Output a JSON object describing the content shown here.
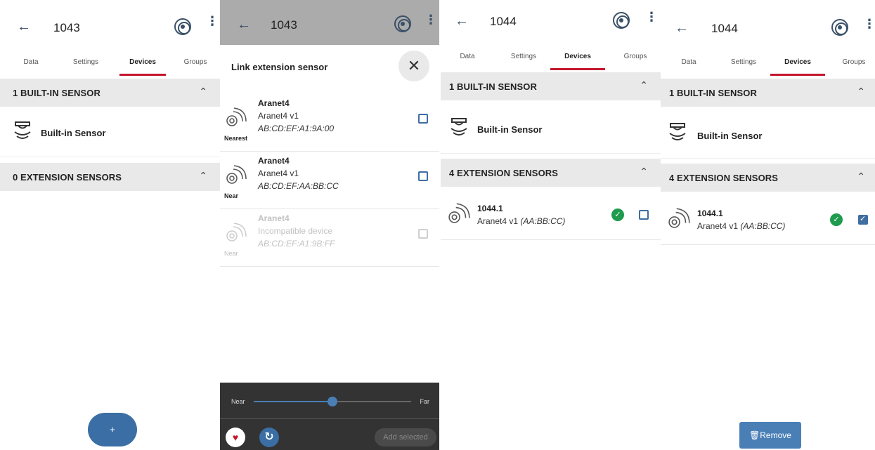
{
  "screens": [
    {
      "title": "1043",
      "tabs": [
        "Data",
        "Settings",
        "Devices",
        "Groups"
      ],
      "active_tab": "Devices",
      "builtin_header": "1 BUILT-IN SENSOR",
      "builtin_name": "Built-in Sensor",
      "ext_header": "0 EXTENSION SENSORS",
      "fab_label": "+"
    },
    {
      "title": "1043",
      "sheet_title": "Link extension sensor",
      "devices": [
        {
          "name": "Aranet4",
          "model": "Aranet4 v1",
          "mac": "AB:CD:EF:A1:9A:00",
          "proximity": "Nearest",
          "compatible": true
        },
        {
          "name": "Aranet4",
          "model": "Aranet4 v1",
          "mac": "AB:CD:EF:AA:BB:CC",
          "proximity": "Near",
          "compatible": true
        },
        {
          "name": "Aranet4",
          "model": "Incompatible device",
          "mac": "AB:CD:EF:A1:9B:FF",
          "proximity": "Near",
          "compatible": false
        }
      ],
      "slider": {
        "near_label": "Near",
        "far_label": "Far",
        "value": 0.5
      },
      "add_selected_label": "Add selected"
    },
    {
      "title": "1044",
      "tabs": [
        "Data",
        "Settings",
        "Devices",
        "Groups"
      ],
      "active_tab": "Devices",
      "builtin_header": "1 BUILT-IN SENSOR",
      "builtin_name": "Built-in Sensor",
      "ext_header": "4 EXTENSION SENSORS",
      "ext_sensor": {
        "name": "1044.1",
        "model": "Aranet4 v1",
        "mac": "(AA:BB:CC)",
        "checked": false
      }
    },
    {
      "title": "1044",
      "tabs": [
        "Data",
        "Settings",
        "Devices",
        "Groups"
      ],
      "active_tab": "Devices",
      "builtin_header": "1 BUILT-IN SENSOR",
      "builtin_name": "Built-in Sensor",
      "ext_header": "4 EXTENSION SENSORS",
      "ext_sensor": {
        "name": "1044.1",
        "model": "Aranet4 v1",
        "mac": "(AA:BB:CC)",
        "checked": true
      },
      "remove_label": "Remove"
    }
  ],
  "icons": {
    "back": "arrow-left-icon",
    "bluetooth_scan": "radar-icon",
    "more": "more-vert-icon",
    "chevron": "chevron-up-icon",
    "sensor_wave": "sensor-wave-icon",
    "builtin_sensor": "builtin-sensor-icon",
    "status_ok": "check-circle-icon",
    "close": "close-icon",
    "heart": "heart-icon",
    "refresh": "refresh-icon",
    "trash": "trash-icon"
  },
  "colors": {
    "accent": "#3a6ea5",
    "tab_indicator": "#c4172d",
    "ok_green": "#1f9b4e",
    "section_bg": "#e9e9e9"
  }
}
